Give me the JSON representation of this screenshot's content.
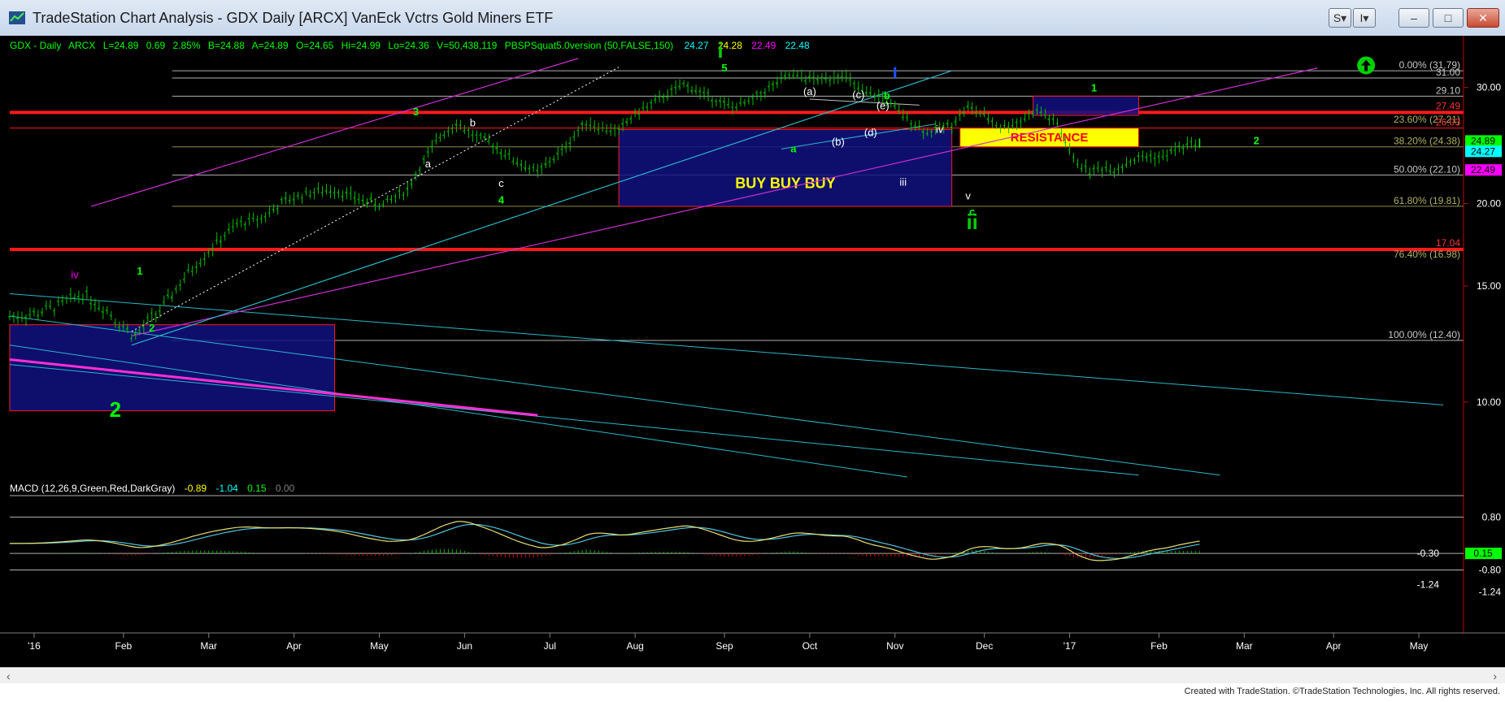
{
  "window": {
    "title": "TradeStation Chart Analysis - GDX Daily [ARCX] VanEck Vctrs Gold Miners ETF",
    "buttons": [
      "S",
      "I",
      "–",
      "□",
      "✕"
    ]
  },
  "header": {
    "symbol": "GDX - Daily",
    "exchange": "ARCX",
    "last": "L=24.89",
    "change": "0.69",
    "change_pct": "2.85%",
    "bid": "B=24.88",
    "ask": "A=24.89",
    "open": "O=24.65",
    "high": "Hi=24.99",
    "low": "Lo=24.36",
    "volume": "V=50,438,119",
    "study": "PBSPSquat5.0version (50,FALSE,150)",
    "study_values": [
      "24.27",
      "24.28",
      "22.49",
      "22.48"
    ]
  },
  "macd_header": {
    "label": "MACD (12,26,9,Green,Red,DarkGray)",
    "values": [
      "-0.89",
      "-1.04",
      "0.15",
      "0.00"
    ]
  },
  "chart_data": {
    "type": "line",
    "title": "GDX Daily [ARCX] VanEck Vctrs Gold Miners ETF",
    "x_ticks": [
      "'16",
      "Feb",
      "Mar",
      "Apr",
      "May",
      "Jun",
      "Jul",
      "Aug",
      "Sep",
      "Oct",
      "Nov",
      "Dec",
      "'17",
      "Feb",
      "Mar",
      "Apr",
      "May"
    ],
    "y_ticks": [
      10.0,
      15.0,
      20.0,
      25.0,
      30.0
    ],
    "ylim": [
      7.7,
      33.0
    ],
    "log_scale": true,
    "series": [
      {
        "name": "GDX",
        "x": [
          0,
          6,
          12,
          18,
          24,
          28,
          31,
          34,
          38,
          44,
          50,
          56,
          62,
          68,
          74,
          80,
          86,
          92,
          98,
          102,
          106,
          110,
          114,
          118,
          124,
          130,
          136,
          142,
          146,
          150,
          154,
          160,
          166,
          170,
          174,
          178,
          182,
          188,
          192,
          196,
          200,
          205,
          210,
          215,
          220,
          226,
          232,
          236,
          240,
          244,
          248,
          252,
          254,
          256,
          258,
          262,
          266,
          270,
          272,
          276,
          280,
          284,
          287,
          290,
          293
        ],
        "values": [
          13.5,
          13.6,
          14.0,
          14.6,
          13.8,
          13.0,
          12.6,
          13.2,
          14.0,
          15.7,
          17.2,
          18.6,
          19.0,
          20.2,
          20.8,
          21.0,
          20.3,
          19.9,
          21.0,
          23.2,
          25.3,
          26.5,
          25.4,
          24.8,
          23.3,
          22.3,
          24.0,
          26.6,
          26.0,
          25.8,
          27.3,
          28.8,
          30.3,
          29.5,
          28.7,
          28.0,
          28.5,
          30.2,
          31.3,
          31.0,
          30.8,
          31.4,
          29.5,
          29.0,
          27.2,
          25.6,
          26.4,
          28.0,
          27.2,
          26.1,
          26.5,
          27.5,
          27.6,
          26.9,
          26.4,
          23.3,
          22.4,
          22.7,
          22.5,
          23.2,
          23.6,
          23.5,
          24.2,
          24.5,
          24.89
        ]
      },
      {
        "name": "Channel upper (magenta)",
        "x": [
          20,
          140
        ],
        "values": [
          19.8,
          33.2
        ]
      },
      {
        "name": "Channel lower (magenta)",
        "x": [
          30,
          322
        ],
        "values": [
          12.6,
          32.1
        ]
      },
      {
        "name": "Trendline (cyan)",
        "x": [
          30,
          232
        ],
        "values": [
          12.2,
          31.8
        ]
      }
    ],
    "horizontal_levels": [
      {
        "label": "0.00% (31.79)",
        "value": 31.79
      },
      {
        "label": "31.00",
        "value": 31.0
      },
      {
        "label": "29.10",
        "value": 29.1
      },
      {
        "label": "27.49",
        "value": 27.49
      },
      {
        "label": "23.60% (27.21)",
        "value": 27.21
      },
      {
        "label": "26.03",
        "value": 26.03
      },
      {
        "label": "38.20% (24.38)",
        "value": 24.38
      },
      {
        "label": "50.00% (22.10)",
        "value": 22.1
      },
      {
        "label": "61.80% (19.81)",
        "value": 19.81
      },
      {
        "label": "17.04",
        "value": 17.04
      },
      {
        "label": "76.40% (16.98)",
        "value": 16.98
      },
      {
        "label": "100.00% (12.40)",
        "value": 12.4
      }
    ],
    "price_tags": [
      {
        "text": "24.89",
        "value": 24.89,
        "color": "#00ff00"
      },
      {
        "text": "24.27",
        "value": 24.27,
        "color": "#00ffff"
      },
      {
        "text": "22.49",
        "value": 22.49,
        "color": "#ff00ff"
      }
    ],
    "boxes": [
      {
        "label": "BUY  BUY  BUY",
        "x": [
          150,
          232
        ],
        "y": [
          19.8,
          25.9
        ]
      },
      {
        "label": "RESISTANCE",
        "x": [
          234,
          278
        ],
        "y": [
          24.38,
          26.03
        ]
      },
      {
        "label": "",
        "x": [
          252,
          278
        ],
        "y": [
          27.21,
          29.1
        ]
      },
      {
        "label": "",
        "x": [
          0,
          80
        ],
        "y": [
          9.7,
          13.1
        ]
      }
    ],
    "wave_labels": [
      {
        "text": "i",
        "x": 175,
        "value": 33.3,
        "color": "#00cc00",
        "big": true
      },
      {
        "text": "5",
        "x": 176,
        "value": 31.7,
        "color": "#00ff00"
      },
      {
        "text": "3",
        "x": 100,
        "value": 27.2,
        "color": "#00ff00"
      },
      {
        "text": "4",
        "x": 121,
        "value": 20.0,
        "color": "#00ff00"
      },
      {
        "text": "a",
        "x": 193,
        "value": 23.9,
        "color": "#00ff00"
      },
      {
        "text": "b",
        "x": 216,
        "value": 28.8,
        "color": "#00ff00"
      },
      {
        "text": "c",
        "x": 237,
        "value": 19.2,
        "color": "#00ff00"
      },
      {
        "text": "ii",
        "x": 237,
        "value": 18.3,
        "color": "#00cc00",
        "big": true
      },
      {
        "text": "1",
        "x": 267,
        "value": 29.6,
        "color": "#00ff00"
      },
      {
        "text": "2",
        "x": 307,
        "value": 24.6,
        "color": "#00ff00"
      },
      {
        "text": "1",
        "x": 32,
        "value": 15.6,
        "color": "#00ff00"
      },
      {
        "text": "2",
        "x": 35,
        "value": 12.8,
        "color": "#00ff00"
      },
      {
        "text": "2",
        "x": 26,
        "value": 9.5,
        "color": "#00ff00",
        "big": true
      },
      {
        "text": "iv",
        "x": 16,
        "value": 15.4,
        "color": "#ff00ff"
      },
      {
        "text": "b",
        "x": 114,
        "value": 26.2,
        "color": "#ffffff"
      },
      {
        "text": "a",
        "x": 103,
        "value": 22.7,
        "color": "#ffffff"
      },
      {
        "text": "c",
        "x": 121,
        "value": 21.2,
        "color": "#ffffff"
      },
      {
        "text": "(a)",
        "x": 197,
        "value": 29.2,
        "color": "#ffffff"
      },
      {
        "text": "(b)",
        "x": 204,
        "value": 24.5,
        "color": "#ffffff"
      },
      {
        "text": "(c)",
        "x": 209,
        "value": 28.9,
        "color": "#ffffff"
      },
      {
        "text": "(d)",
        "x": 212,
        "value": 25.3,
        "color": "#ffffff"
      },
      {
        "text": "(e)",
        "x": 215,
        "value": 27.8,
        "color": "#ffffff"
      },
      {
        "text": "iii",
        "x": 220,
        "value": 21.3,
        "color": "#ffffff"
      },
      {
        "text": "iv",
        "x": 229,
        "value": 25.6,
        "color": "#ffffff"
      },
      {
        "text": "v",
        "x": 236,
        "value": 20.3,
        "color": "#ffffff"
      }
    ],
    "macd": {
      "x_ticks": [
        "-1.24",
        "-0.30",
        "0.80",
        "-0.80"
      ],
      "right_labels": [
        "0.80",
        "-0.30",
        "0.15",
        "-0.80",
        "-1.24"
      ],
      "ylim": [
        -1.6,
        1.3
      ]
    },
    "grid": false,
    "background": "#000000"
  },
  "footer": {
    "credit": "Created with TradeStation. ©TradeStation Technologies, Inc. All rights reserved."
  }
}
